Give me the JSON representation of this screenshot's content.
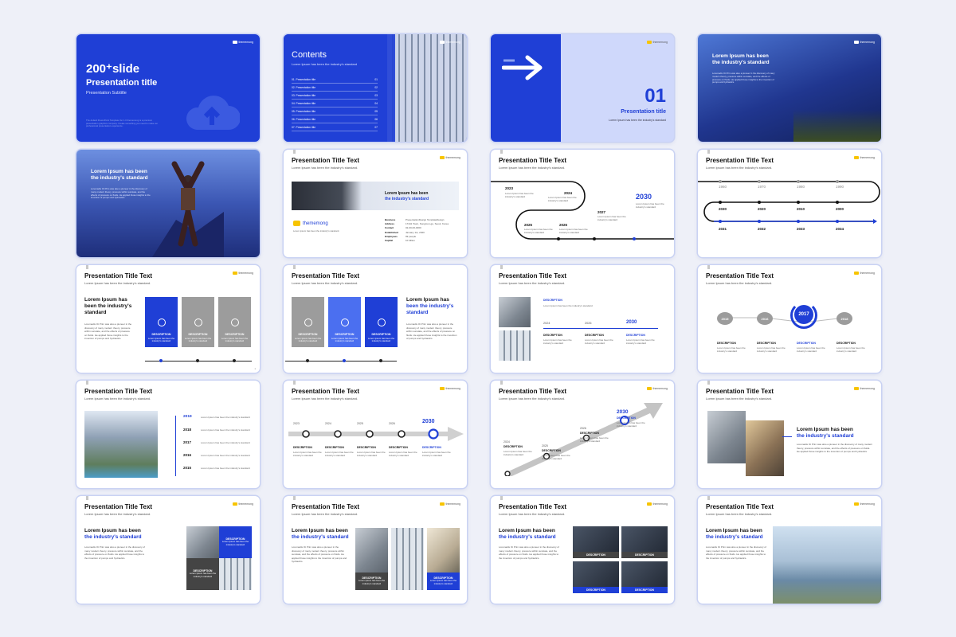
{
  "brand": {
    "logo_text": "thememong",
    "blue": "#1f3fd6",
    "yellow": "#f7c400"
  },
  "common": {
    "slide_title": "Presentation Title Text",
    "slide_subtitle": "Lorem Ipsum has been the industry's standard.",
    "lorem_a": "Lorem Ipsum has been",
    "lorem_b": "the industry's standard",
    "lorem_a_short": "Lorem Ipsum has",
    "lorem_b_short": "been the industry's",
    "lorem_c_short": "standard",
    "body": "Loremadis Ot Prim was also a pioneer in the discovery of many modern theory, pressure within sunstate, and the effects of pressure on fluids. He applied those insights to the invention of pumps and hydraulics.",
    "desc": "DESCRIPTION",
    "desc_text": "Lorem Ipsum has been the industry's standard",
    "page_number": "1"
  },
  "cover": {
    "title_big": "200⁺slide",
    "title": "Presentation title",
    "subtitle": "Presentation Subtitle",
    "note": "The default PowerPoint Template Ver 1.0 thememong is a premium presentation graphics company. Create something you need to make our professional presentation experience."
  },
  "contents": {
    "title": "Contents",
    "subtitle": "Lorem Ipsum has been the industry's standard",
    "items": [
      {
        "label": "01. Presentation title",
        "num": "01"
      },
      {
        "label": "02. Presentation title",
        "num": "02"
      },
      {
        "label": "03. Presentation title",
        "num": "03"
      },
      {
        "label": "04. Presentation title",
        "num": "04"
      },
      {
        "label": "05. Presentation title",
        "num": "05"
      },
      {
        "label": "06. Presentation title",
        "num": "06"
      },
      {
        "label": "07. Presentation title",
        "num": "07"
      }
    ]
  },
  "section": {
    "number": "01",
    "title": "Presentation title",
    "subtitle": "Lorem Ipsum has been the industry's standard"
  },
  "profile": {
    "banner_a": "Lorem Ipsum has been",
    "banner_b": "the industry's standard",
    "logo": "thememong",
    "logo_sub": "Lorem ipsum has been the industry's standard.",
    "rows": [
      {
        "k": "Business",
        "v": "PresentationDesign TemplateDesign"
      },
      {
        "k": "Address",
        "v": "17441 Town, Songmun-gu, Seoul, Korea"
      },
      {
        "k": "Contact",
        "v": "02-00-00-0000"
      },
      {
        "k": "Established",
        "v": "January 1st, 2020"
      },
      {
        "k": "Employees",
        "v": "99 people"
      },
      {
        "k": "Capital",
        "v": "10 billion"
      }
    ]
  },
  "timeline_wave": {
    "years": [
      "2023",
      "2024",
      "2025",
      "2026",
      "2027",
      "2030"
    ]
  },
  "timeline_snake": {
    "rows": [
      [
        "1960",
        "1970",
        "1980",
        "1990"
      ],
      [
        "2030",
        "2020",
        "2010",
        "2000"
      ],
      [
        "2031",
        "2032",
        "2033",
        "2034"
      ]
    ]
  },
  "timeline_list": {
    "years": [
      "2019",
      "2018",
      "2017",
      "2016",
      "2015"
    ]
  },
  "timeline_arrow": {
    "years": [
      "2023",
      "2024",
      "2025",
      "2026",
      "2030"
    ]
  },
  "timeline_diag": {
    "years": [
      "2030",
      "2026",
      "2025",
      "2024"
    ]
  },
  "timeline_small": {
    "years": [
      "2024",
      "2026",
      "2030"
    ]
  },
  "timeline_circles": {
    "years": [
      "2015",
      "2016",
      "2017",
      "2018"
    ]
  }
}
